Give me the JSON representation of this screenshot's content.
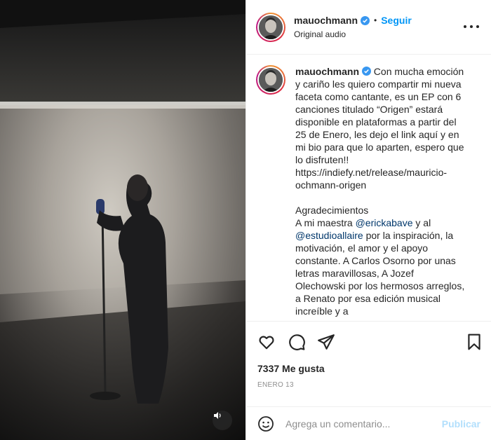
{
  "post": {
    "username": "mauochmann",
    "follow_label": "Seguir",
    "dot": "•",
    "audio_label": "Original audio",
    "verified_icon": "verified-badge-icon"
  },
  "caption": {
    "username": "mauochmann",
    "text_part1": "Con mucha emoción y cariño les quiero compartir mi nueva faceta como cantante, es un EP con 6 canciones titulado “Origen” estará disponible en plataformas a partir del 25 de Enero, les dejo el link aquí y en mi bio para que lo aparten, espero que lo disfruten!!\nhttps://indiefy.net/release/mauricio-ochmann-origen\n\nAgradecimientos\nA mi maestra ",
    "mention1": "@erickabave",
    "text_part2": " y al ",
    "mention2": "@estudioallaire",
    "text_part3": " por la inspiración, la motivación, el amor y el apoyo constante. A Carlos Osorno por unas letras maravillosas, A Jozef Olechowski por los hermosos arreglos, a Renato por esa edición musical increíble y a"
  },
  "stats": {
    "likes": "7337 Me gusta",
    "date": "ENERO 13"
  },
  "comment": {
    "placeholder": "Agrega un comentario...",
    "publish_label": "Publicar"
  },
  "icons": {
    "like": "heart-icon",
    "comment": "comment-icon",
    "share": "paper-plane-icon",
    "save": "bookmark-icon",
    "emoji": "smiley-icon",
    "more": "more-dots-icon",
    "mute": "speaker-icon"
  },
  "colors": {
    "accent": "#0095f6",
    "publish_disabled": "#b2dffc",
    "mention": "#00376b",
    "muted_text": "#8e8e8e"
  }
}
